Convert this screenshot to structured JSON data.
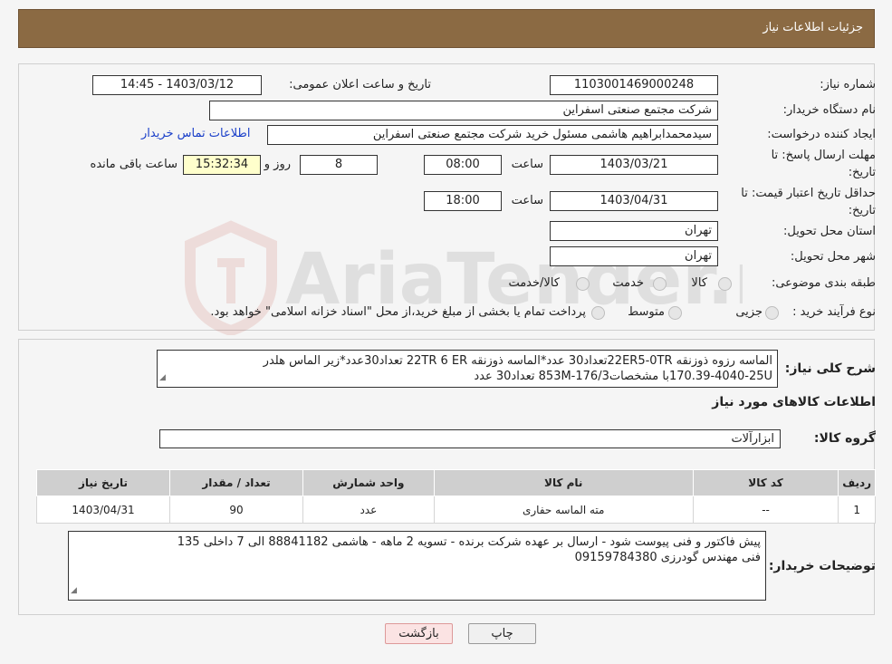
{
  "header": {
    "title": "جزئیات اطلاعات نیاز"
  },
  "watermark": {
    "text": "AriaTender.neT"
  },
  "fields": {
    "need_number_label": "شماره نیاز:",
    "need_number": "1103001469000248",
    "announce_label": "تاریخ و ساعت اعلان عمومی:",
    "announce_value": "1403/03/12 - 14:45",
    "buyer_org_label": "نام دستگاه خریدار:",
    "buyer_org": "شرکت مجتمع صنعتی اسفراین",
    "creator_label": "ایجاد کننده درخواست:",
    "creator": "سیدمحمدابراهیم هاشمی مسئول خرید شرکت مجتمع صنعتی اسفراین",
    "contact_link": "اطلاعات تماس خریدار",
    "reply_deadline_label_1": "مهلت ارسال پاسخ: تا",
    "reply_deadline_label_2": "تاریخ:",
    "reply_date": "1403/03/21",
    "time_label": "ساعت",
    "reply_time": "08:00",
    "days_value": "8",
    "days_label": "روز و",
    "remaining_time": "15:32:34",
    "remaining_label": "ساعت باقی مانده",
    "validity_label_1": "حداقل تاریخ اعتبار قیمت: تا",
    "validity_label_2": "تاریخ:",
    "validity_date": "1403/04/31",
    "validity_time": "18:00",
    "province_label": "استان محل تحویل:",
    "province": "تهران",
    "city_label": "شهر محل تحویل:",
    "city": "تهران",
    "category_label": "طبقه بندی موضوعی:",
    "category_options": [
      "کالا",
      "خدمت",
      "کالا/خدمت"
    ],
    "process_label": "نوع فرآیند خرید :",
    "process_options": [
      "جزیی",
      "متوسط"
    ],
    "process_note": "پرداخت تمام یا بخشی از مبلغ خرید،از محل \"اسناد خزانه اسلامی\" خواهد بود."
  },
  "summary": {
    "label": "شرح کلی نیاز:",
    "line1": "الماسه رزوه ذوزنقه 22ER5-0TRتعداد30 عدد*الماسه ذوزنقه 22TR 6 ER تعداد30عدد*زیر الماس هلدر",
    "line2": "170.39-4040-25Uبا مشخصات853M-176/3 تعداد30 عدد"
  },
  "items_section_title": "اطلاعات کالاهای مورد نیاز",
  "goods_group": {
    "label": "گروه کالا:",
    "value": "ابزارآلات"
  },
  "table": {
    "headers": [
      "ردیف",
      "کد کالا",
      "نام کالا",
      "واحد شمارش",
      "تعداد / مقدار",
      "تاریخ نیاز"
    ],
    "rows": [
      [
        "1",
        "--",
        "مته الماسه حفاری",
        "عدد",
        "90",
        "1403/04/31"
      ]
    ]
  },
  "buyer_notes": {
    "label": "توضیحات خریدار:",
    "line1": "پیش فاکتور و فنی پیوست شود - ارسال بر عهده شرکت برنده - تسویه 2 ماهه - هاشمی 88841182 الی 7 داخلی 135",
    "line2": "فنی مهندس گودرزی 09159784380"
  },
  "buttons": {
    "back": "بازگشت",
    "print": "چاپ"
  }
}
